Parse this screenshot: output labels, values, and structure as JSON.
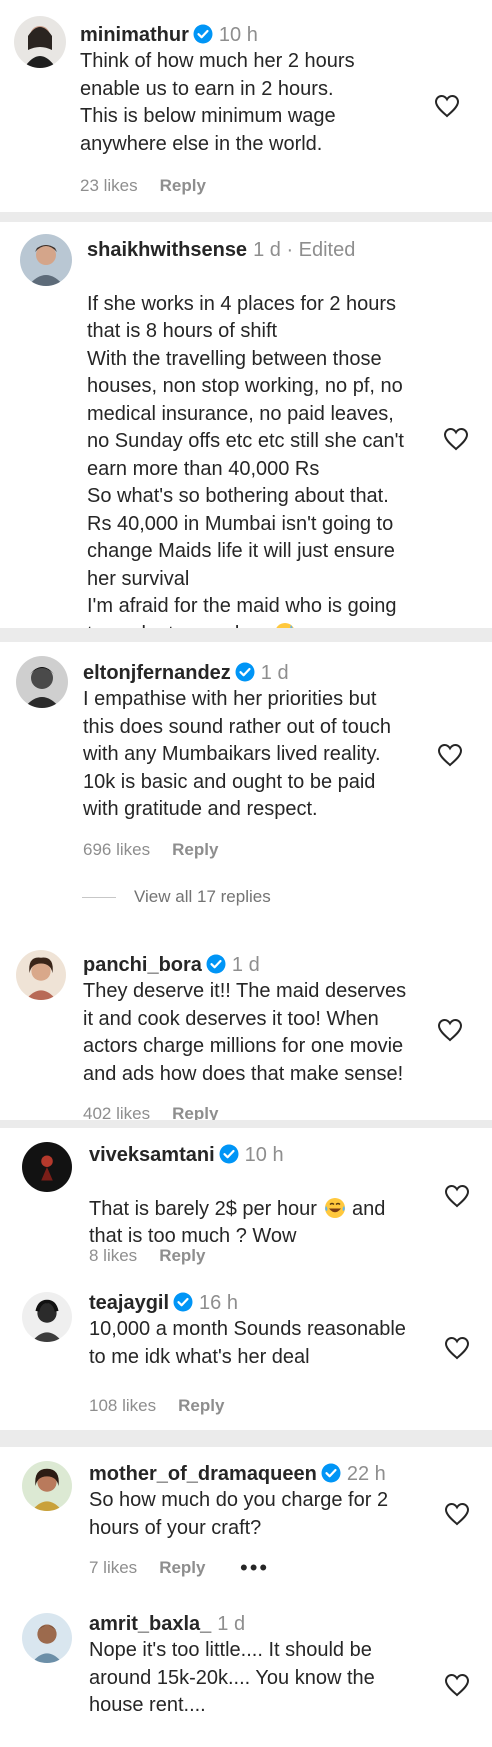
{
  "comments": [
    {
      "username": "minimathur",
      "verified": true,
      "time": "10 h",
      "edited": "",
      "text": "Think of how much her 2 hours\nenable us to earn in 2 hours.\nThis is below minimum wage\nanywhere else in the world.",
      "likes": "23 likes",
      "reply": "Reply"
    },
    {
      "username": "shaikhwithsense",
      "verified": false,
      "time": "1 d",
      "edited": "· Edited",
      "text": "If she works in 4 places for 2 hours\nthat is 8 hours of shift\nWith the travelling between those\nhouses, non stop working, no pf, no\nmedical insurance, no paid leaves,\nno Sunday offs etc etc still she can't\nearn more than 40,000 Rs\nSo what's so bothering about that.\nRs 40,000 in Mumbai isn't going to\nchange Maids life it will just ensure\nher survival\nI'm afraid for the maid who is going\nto work at your place",
      "likes": "",
      "reply": ""
    },
    {
      "username": "eltonjfernandez",
      "verified": true,
      "time": "1 d",
      "edited": "",
      "text": "I empathise with her priorities but\nthis does sound rather out of touch\nwith any Mumbaikars lived reality.\n10k is basic and ought to be paid\nwith gratitude and respect.",
      "likes": "696 likes",
      "reply": "Reply",
      "view_replies": "View all 17 replies"
    },
    {
      "username": "panchi_bora",
      "verified": true,
      "time": "1 d",
      "edited": "",
      "text": "They deserve it!! The maid deserves\nit and cook deserves it too! When\nactors charge millions for one movie\nand ads how does that make sense!",
      "likes": "402 likes",
      "reply": "Reply"
    },
    {
      "username": "viveksamtani",
      "verified": true,
      "time": "10 h",
      "edited": "",
      "text_part1": "That is barely 2$ per hour",
      "text_part2": "and\nthat is too much ? Wow",
      "likes": "8 likes",
      "reply": "Reply"
    },
    {
      "username": "teajaygil",
      "verified": true,
      "time": "16 h",
      "edited": "",
      "text": "10,000 a month Sounds reasonable\nto me idk what's her deal",
      "likes": "108 likes",
      "reply": "Reply"
    },
    {
      "username": "mother_of_dramaqueen",
      "verified": true,
      "time": "22 h",
      "edited": "",
      "text": "So how much do you charge for 2\nhours of your craft?",
      "likes": "7 likes",
      "reply": "Reply",
      "more": "•••"
    },
    {
      "username": "amrit_baxla_",
      "verified": false,
      "time": "1 d",
      "edited": "",
      "text": "Nope it's too little.... It should be\naround 15k-20k.... You know the\nhouse rent....",
      "likes": "",
      "reply": ""
    }
  ],
  "colors": {
    "verified_blue": "#0095f6",
    "meta_gray": "#8e8e8e",
    "background": "#ebebeb"
  },
  "icons": {
    "like": "heart-outline-icon",
    "verified": "verified-badge-icon",
    "sweat_smile": "grinning-sweat-emoji",
    "laughing": "tears-of-joy-emoji"
  }
}
